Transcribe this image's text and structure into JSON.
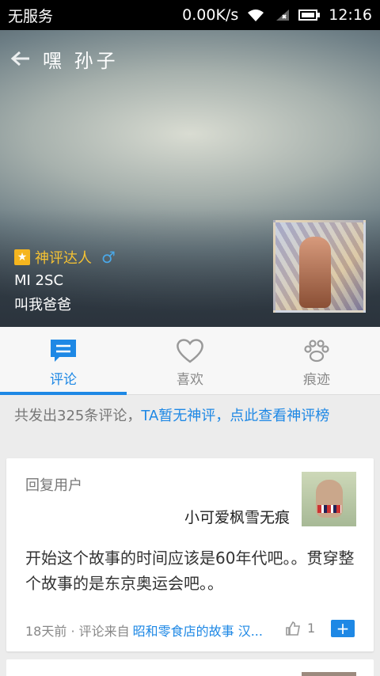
{
  "status_bar": {
    "carrier": "无服务",
    "speed": "0.00K/s",
    "time": "12:16",
    "icons": [
      "wifi-icon",
      "signal-icon",
      "battery-icon"
    ]
  },
  "header": {
    "title": "嘿 孙子",
    "back_icon": "arrow-left-icon"
  },
  "profile": {
    "badge": "神评达人",
    "gender_icon": "male-icon",
    "gender_symbol": "♂",
    "device": "MI 2SC",
    "signature": "叫我爸爸"
  },
  "tabs": [
    {
      "label": "评论",
      "icon": "comment-icon",
      "active": true
    },
    {
      "label": "喜欢",
      "icon": "heart-icon",
      "active": false
    },
    {
      "label": "痕迹",
      "icon": "paw-icon",
      "active": false
    }
  ],
  "summary": {
    "prefix": "共发出325条评论，",
    "link": "TA暂无神评，点此查看神评榜"
  },
  "comment": {
    "reply_label": "回复用户",
    "reply_user": "小可爱枫雪无痕",
    "text": "开始这个故事的时间应该是60年代吧。。贯穿整个故事的是东京奥运会吧。。",
    "meta_prefix": "18天前 · 评论来自",
    "source": "昭和零食店的故事 汉...",
    "like_count": "1",
    "add_symbol": "+"
  },
  "colors": {
    "accent": "#1e88e5",
    "badge": "#f5c233"
  }
}
